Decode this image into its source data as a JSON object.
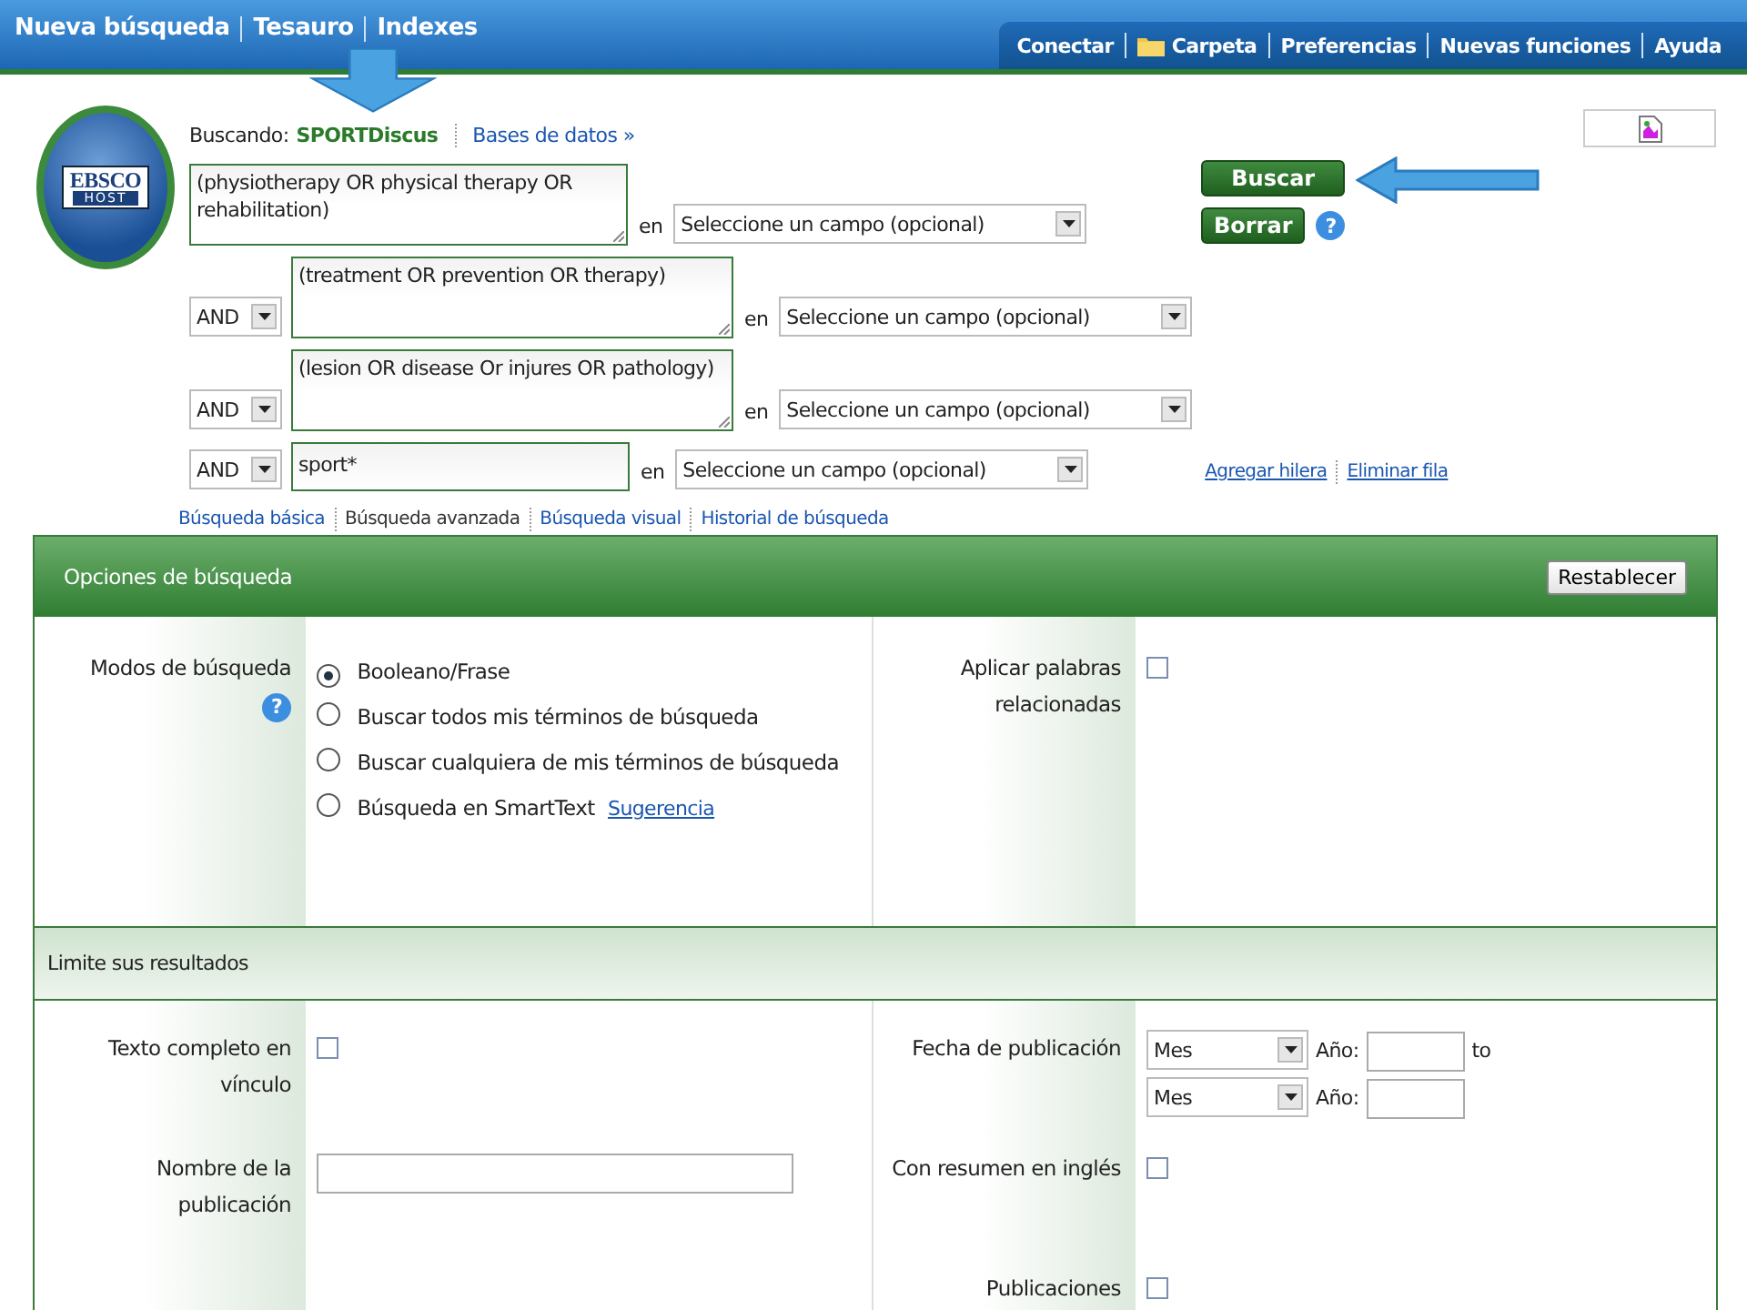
{
  "top_nav": {
    "left": [
      "Nueva búsqueda",
      "Tesauro",
      "Indexes"
    ],
    "right": [
      {
        "label": "Conectar",
        "kind": "link"
      },
      {
        "label": "Carpeta",
        "kind": "folder"
      },
      {
        "label": "Preferencias",
        "kind": "link"
      },
      {
        "label": "Nuevas funciones",
        "kind": "link"
      },
      {
        "label": "Ayuda",
        "kind": "link"
      }
    ]
  },
  "logo": {
    "top": "EBSCO",
    "bottom": "HOST"
  },
  "searching": {
    "label": "Buscando:",
    "database": "SPORTDiscus",
    "link": "Bases de datos »"
  },
  "rows": [
    {
      "kind": "textarea",
      "value": "(physiotherapy OR physical therapy OR rehabilitation)",
      "en": "en",
      "field": "Seleccione un campo (opcional)"
    },
    {
      "kind": "textarea",
      "operator": "AND",
      "value": "(treatment OR prevention OR therapy)",
      "en": "en",
      "field": "Seleccione un campo (opcional)"
    },
    {
      "kind": "textarea",
      "operator": "AND",
      "value": "(lesion OR disease Or injures OR pathology)",
      "en": "en",
      "field": "Seleccione un campo (opcional)"
    },
    {
      "kind": "input",
      "operator": "AND",
      "value": "sport*",
      "en": "en",
      "field": "Seleccione un campo (opcional)"
    }
  ],
  "buttons": [
    "Buscar",
    "Borrar"
  ],
  "buttons_help": "?",
  "row_links": [
    "Agregar hilera",
    "Eliminar fila"
  ],
  "search_tabs": [
    {
      "label": "Búsqueda básica",
      "selected": false
    },
    {
      "label": "Búsqueda avanzada",
      "selected": true
    },
    {
      "label": "Búsqueda visual",
      "selected": false
    },
    {
      "label": "Historial de búsqueda",
      "selected": false
    }
  ],
  "options": {
    "title": "Opciones de búsqueda",
    "reset": "Restablecer",
    "modes_label": "Modos de búsqueda",
    "help": "?",
    "modes": [
      {
        "label": "Booleano/Frase",
        "selected": true
      },
      {
        "label": "Buscar todos mis términos de búsqueda",
        "selected": false
      },
      {
        "label": "Buscar cualquiera de mis términos de búsqueda",
        "selected": false
      },
      {
        "label": "Búsqueda en SmartText",
        "selected": false,
        "link": "Sugerencia"
      }
    ],
    "related": {
      "label": "Aplicar palabras relacionadas",
      "checked": false
    }
  },
  "limits": {
    "title": "Limite sus resultados",
    "full_text": {
      "label": "Texto completo en vínculo",
      "checked": false
    },
    "publication_date": {
      "label": "Fecha de publicación",
      "rows": [
        {
          "month": "Mes",
          "year_label": "Año:",
          "to": "to"
        },
        {
          "month": "Mes",
          "year_label": "Año:"
        }
      ]
    },
    "publication_name": {
      "label": "Nombre de la publicación"
    },
    "abstract": {
      "label": "Con resumen en inglés",
      "checked": false
    },
    "publications": {
      "label": "Publicaciones",
      "checked": false
    }
  }
}
